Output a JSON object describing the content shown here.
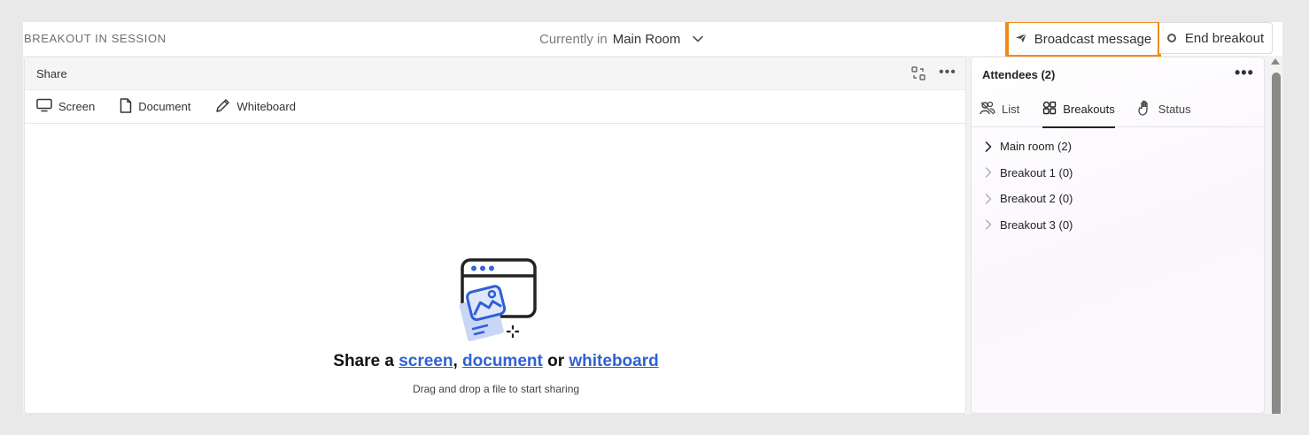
{
  "topbar": {
    "session_label": "BREAKOUT IN SESSION",
    "room_prefix": "Currently in",
    "room_name": "Main Room",
    "broadcast_label": "Broadcast message",
    "end_label": "End breakout"
  },
  "share": {
    "title": "Share",
    "tabs": [
      {
        "label": "Screen",
        "icon": "monitor-icon"
      },
      {
        "label": "Document",
        "icon": "document-icon"
      },
      {
        "label": "Whiteboard",
        "icon": "pencil-icon"
      }
    ],
    "prompt_prefix": "Share a",
    "link_screen": "screen",
    "sep_comma": ",",
    "link_document": "document",
    "sep_or": "or",
    "link_whiteboard": "whiteboard",
    "hint": "Drag and drop a file to start sharing"
  },
  "attendees": {
    "title": "Attendees (2)",
    "tabs": [
      {
        "label": "List",
        "icon": "people-icon"
      },
      {
        "label": "Breakouts",
        "icon": "breakouts-icon",
        "active": true
      },
      {
        "label": "Status",
        "icon": "hand-icon"
      }
    ],
    "rooms": [
      {
        "label": "Main room (2)"
      },
      {
        "label": "Breakout 1 (0)"
      },
      {
        "label": "Breakout 2 (0)"
      },
      {
        "label": "Breakout 3 (0)"
      }
    ]
  },
  "colors": {
    "highlight": "#f08a18",
    "link": "#2f62d6"
  }
}
